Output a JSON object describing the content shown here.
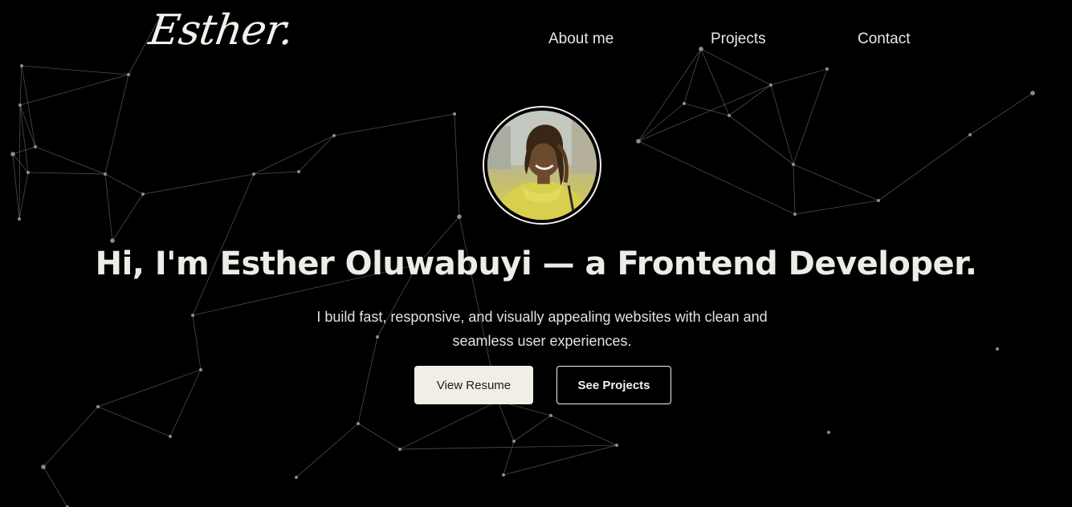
{
  "logo": {
    "text": "Esther."
  },
  "nav": {
    "about": "About me",
    "projects": "Projects",
    "contact": "Contact"
  },
  "hero": {
    "headline": "Hi, I'm Esther Oluwabuyi — a Frontend Developer.",
    "subtitle_line1": "I build fast, responsive, and visually appealing websites with clean and",
    "subtitle_line2": "seamless user experiences.",
    "primary_button": "View Resume",
    "secondary_button": "See Projects"
  },
  "colors": {
    "background": "#000000",
    "text": "#eeece6",
    "primary_button_bg": "#f1eee6",
    "network_lines": "#8a8a8a"
  },
  "icons": {
    "avatar": "profile-photo"
  }
}
